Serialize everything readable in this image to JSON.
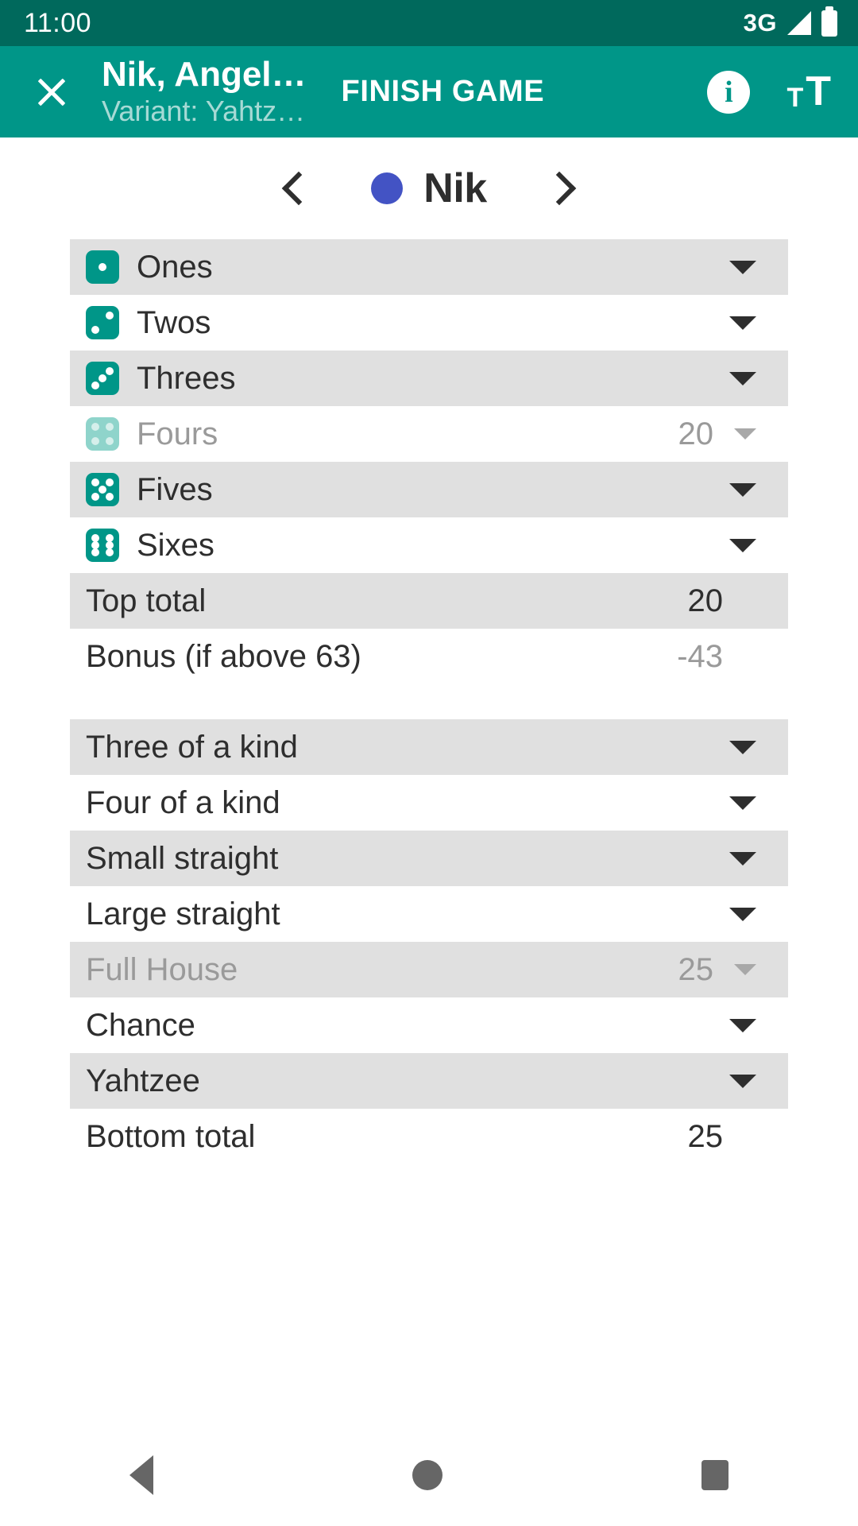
{
  "status_bar": {
    "clock": "11:00",
    "network": "3G",
    "signal_icon": "signal-triangle-icon",
    "battery_icon": "battery-full-icon"
  },
  "app_bar": {
    "close_icon": "close-icon",
    "title": "Nik, Angel…",
    "subtitle": "Variant: Yahtz…",
    "finish_label": "FINISH GAME",
    "info_icon": "info-icon",
    "info_glyph": "i",
    "text_size_icon": "text-size-icon",
    "text_size_small": "T",
    "text_size_big": "T",
    "accent_color": "#009688"
  },
  "player_nav": {
    "prev_icon": "chevron-left-icon",
    "next_icon": "chevron-right-icon",
    "player_name": "Nik",
    "player_color": "#4353C4"
  },
  "scorecard": {
    "upper": [
      {
        "label": "Ones",
        "die": 1,
        "value": "",
        "filled": false,
        "shaded": true
      },
      {
        "label": "Twos",
        "die": 2,
        "value": "",
        "filled": false,
        "shaded": false
      },
      {
        "label": "Threes",
        "die": 3,
        "value": "",
        "filled": false,
        "shaded": true
      },
      {
        "label": "Fours",
        "die": 4,
        "value": "20",
        "filled": true,
        "shaded": false
      },
      {
        "label": "Fives",
        "die": 5,
        "value": "",
        "filled": false,
        "shaded": true
      },
      {
        "label": "Sixes",
        "die": 6,
        "value": "",
        "filled": false,
        "shaded": false
      }
    ],
    "upper_totals": [
      {
        "label": "Top total",
        "value": "20",
        "shaded": true,
        "muted": false
      },
      {
        "label": "Bonus (if above 63)",
        "value": "-43",
        "shaded": false,
        "muted": true
      }
    ],
    "lower": [
      {
        "label": "Three of a kind",
        "value": "",
        "filled": false,
        "shaded": true
      },
      {
        "label": "Four of a kind",
        "value": "",
        "filled": false,
        "shaded": false
      },
      {
        "label": "Small straight",
        "value": "",
        "filled": false,
        "shaded": true
      },
      {
        "label": "Large straight",
        "value": "",
        "filled": false,
        "shaded": false
      },
      {
        "label": "Full House",
        "value": "25",
        "filled": true,
        "shaded": true
      },
      {
        "label": "Chance",
        "value": "",
        "filled": false,
        "shaded": false
      },
      {
        "label": "Yahtzee",
        "value": "",
        "filled": false,
        "shaded": true
      }
    ],
    "lower_totals": [
      {
        "label": "Bottom total",
        "value": "25",
        "shaded": false,
        "muted": false
      }
    ]
  },
  "nav_bar": {
    "back_icon": "back-triangle-icon",
    "home_icon": "home-circle-icon",
    "recents_icon": "recents-square-icon"
  }
}
